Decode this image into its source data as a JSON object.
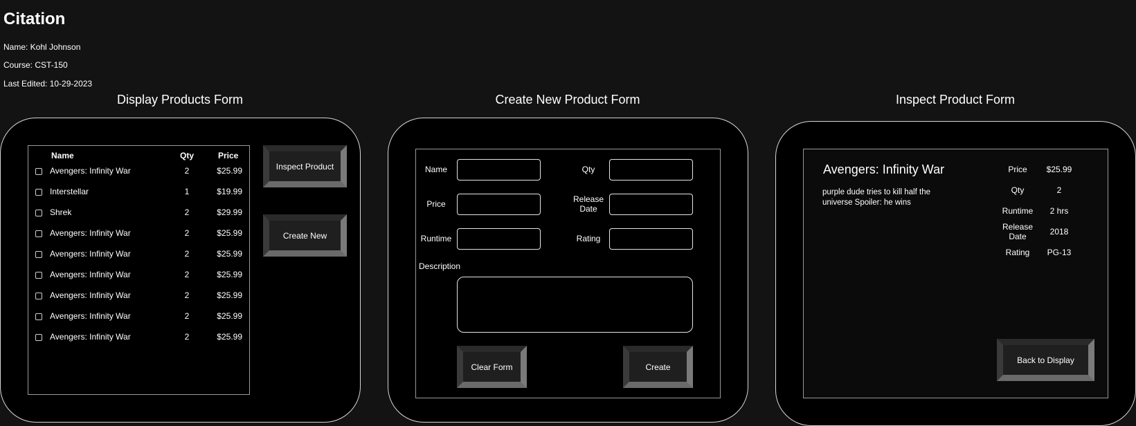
{
  "citation": {
    "title": "Citation",
    "name": "Name: Kohl Johnson",
    "course": "Course: CST-150",
    "edited": "Last Edited: 10-29-2023"
  },
  "display_form": {
    "title": "Display Products Form",
    "headers": {
      "name": "Name",
      "qty": "Qty",
      "price": "Price"
    },
    "rows": [
      {
        "name": "Avengers: Infinity War",
        "qty": "2",
        "price": "$25.99"
      },
      {
        "name": "Interstellar",
        "qty": "1",
        "price": "$19.99"
      },
      {
        "name": "Shrek",
        "qty": "2",
        "price": "$29.99"
      },
      {
        "name": "Avengers: Infinity War",
        "qty": "2",
        "price": "$25.99"
      },
      {
        "name": "Avengers: Infinity War",
        "qty": "2",
        "price": "$25.99"
      },
      {
        "name": "Avengers: Infinity War",
        "qty": "2",
        "price": "$25.99"
      },
      {
        "name": "Avengers: Infinity War",
        "qty": "2",
        "price": "$25.99"
      },
      {
        "name": "Avengers: Infinity War",
        "qty": "2",
        "price": "$25.99"
      },
      {
        "name": "Avengers: Infinity War",
        "qty": "2",
        "price": "$25.99"
      }
    ],
    "inspect_button": "Inspect Product",
    "create_new_button": "Create New"
  },
  "create_form": {
    "title": "Create New Product Form",
    "labels": {
      "name": "Name",
      "qty": "Qty",
      "price": "Price",
      "release_date_1": "Release",
      "release_date_2": "Date",
      "runtime": "Runtime",
      "rating": "Rating",
      "description": "Description"
    },
    "values": {
      "name": "",
      "qty": "",
      "price": "",
      "release_date": "",
      "runtime": "",
      "rating": "",
      "description": ""
    },
    "clear_button": "Clear Form",
    "create_button": "Create"
  },
  "inspect_form": {
    "title": "Inspect Product Form",
    "product_title": "Avengers: Infinity War",
    "description": "purple dude tries to kill half the universe Spoiler: he wins",
    "labels": {
      "price": "Price",
      "qty": "Qty",
      "runtime": "Runtime",
      "release_1": "Release",
      "release_2": "Date",
      "rating": "Rating"
    },
    "values": {
      "price": "$25.99",
      "qty": "2",
      "runtime": "2 hrs",
      "release": "2018",
      "rating": "PG-13"
    },
    "back_button": "Back to Display"
  },
  "colors": {
    "page_bg": "#131313",
    "panel_bg": "#000000",
    "panel_border": "#d8d8d8",
    "text": "#ffffff"
  }
}
